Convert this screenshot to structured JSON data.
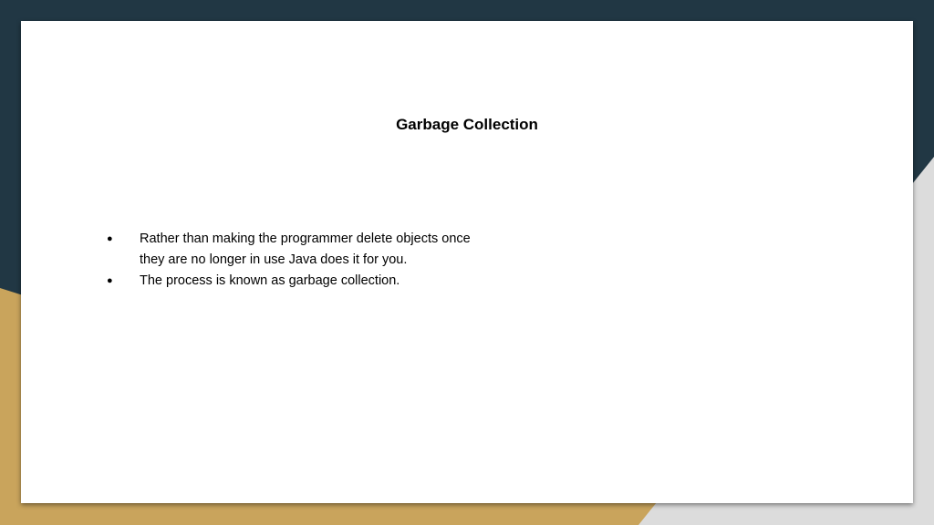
{
  "slide": {
    "title": "Garbage Collection",
    "bullets": [
      {
        "marker": "●",
        "text": "Rather than making the programmer delete objects once they are no longer in use Java does it for you."
      },
      {
        "marker": "●",
        "text": "The process is known as garbage collection."
      }
    ]
  },
  "colors": {
    "background_dark": "#213744",
    "background_gold": "#c9a45c",
    "background_light": "#dcdcdc",
    "card": "#ffffff",
    "text": "#000000"
  }
}
